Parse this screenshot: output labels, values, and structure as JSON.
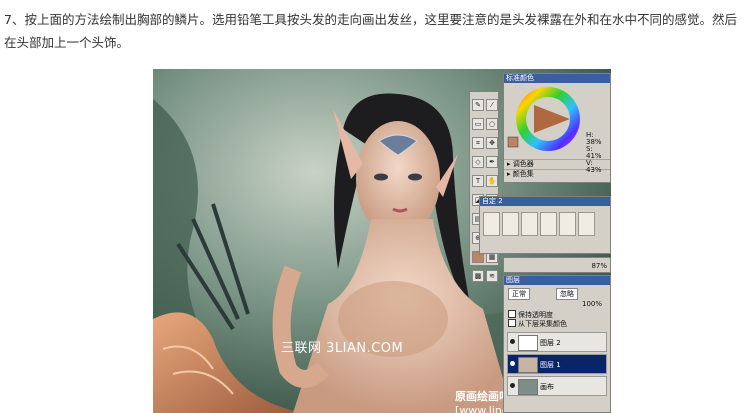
{
  "article": {
    "paragraph": "7、按上面的方法绘制出胸部的鳞片。选用铅笔工具按头发的走向画出发丝，这里要注意的是头发裸露在外和在水中不同的感觉。然后在头部加上一个头饰。"
  },
  "watermarks": {
    "site": "三联网 3LIAN.COM",
    "credit_bold": "原画绘画吧",
    "credit_url": "[www.linecg.com/tieba/1797]"
  },
  "painter": {
    "colors_title": "标准颜色",
    "color_readout": [
      "H: 38%",
      "S: 41%",
      "V: 43%"
    ],
    "mixer_label": "调色器",
    "swatch_label": "颜色集",
    "brush_title": "自定 2",
    "strip_value": "87%",
    "layers_title": "图层",
    "composite_method": "正常",
    "composite_depth": "忽略",
    "opacity": "100%",
    "preserve_transparency": "保持透明度",
    "pick_up_color": "从下层采集颜色",
    "layers": [
      {
        "name": "图层 2",
        "selected": false
      },
      {
        "name": "图层 1",
        "selected": true
      },
      {
        "name": "画布",
        "selected": false
      }
    ]
  }
}
